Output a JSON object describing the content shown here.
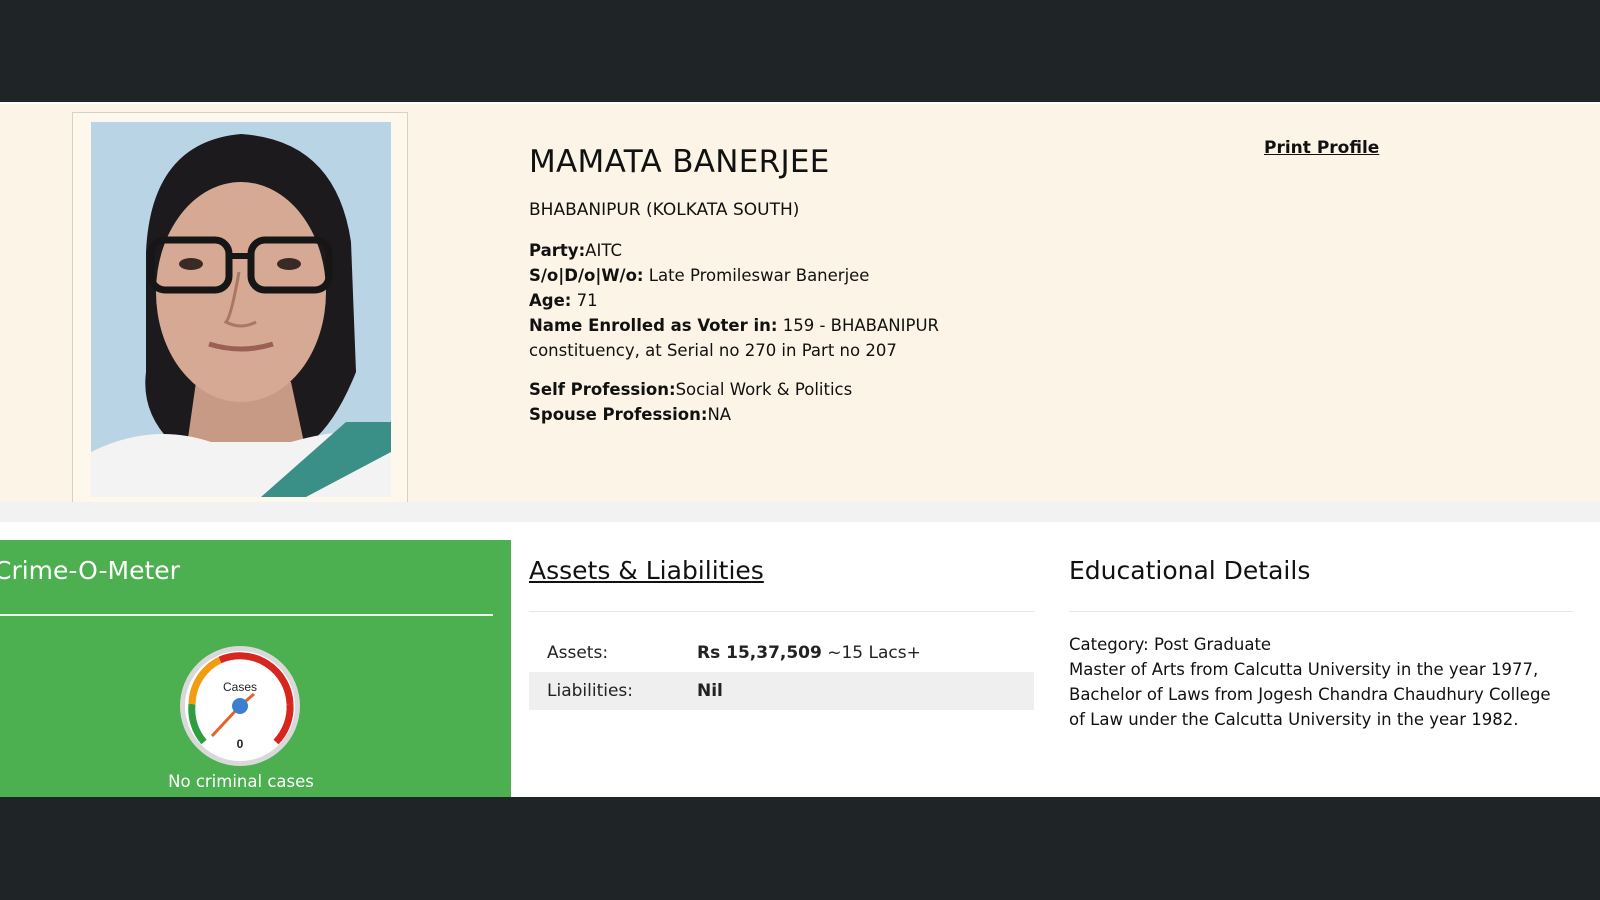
{
  "profile": {
    "name": "MAMATA BANERJEE",
    "constituency": "BHABANIPUR (KOLKATA SOUTH)",
    "party_label": "Party:",
    "party": "AITC",
    "relation_label": "S/o|D/o|W/o:",
    "relation": "Late Promileswar Banerjee",
    "age_label": "Age:",
    "age": "71",
    "voter_label": "Name Enrolled as Voter in:",
    "voter_line1": "159 - BHABANIPUR",
    "voter_line2": "constituency, at Serial no 270 in Part no 207",
    "self_profession_label": "Self Profession:",
    "self_profession": "Social Work & Politics",
    "spouse_profession_label": "Spouse Profession:",
    "spouse_profession": "NA",
    "print_label": "Print Profile"
  },
  "crime": {
    "title": "Crime-O-Meter",
    "gauge_label": "Cases",
    "gauge_value": "0",
    "caption": "No criminal cases"
  },
  "assets": {
    "title": "Assets & Liabilities",
    "assets_label": "Assets:",
    "assets_value": "Rs 15,37,509",
    "assets_approx": "~15 Lacs+",
    "liabilities_label": "Liabilities:",
    "liabilities_value": "Nil"
  },
  "education": {
    "title": "Educational Details",
    "category": "Category: Post Graduate",
    "line1": "Master of Arts from Calcutta University in the year 1977,",
    "line2": "Bachelor of Laws from Jogesh Chandra Chaudhury College",
    "line3": "of Law under the Calcutta University in the year 1982."
  },
  "colors": {
    "crime_bg": "#4caf50",
    "profile_bg": "#fcf4e6",
    "frame_bg": "#1f2426"
  }
}
